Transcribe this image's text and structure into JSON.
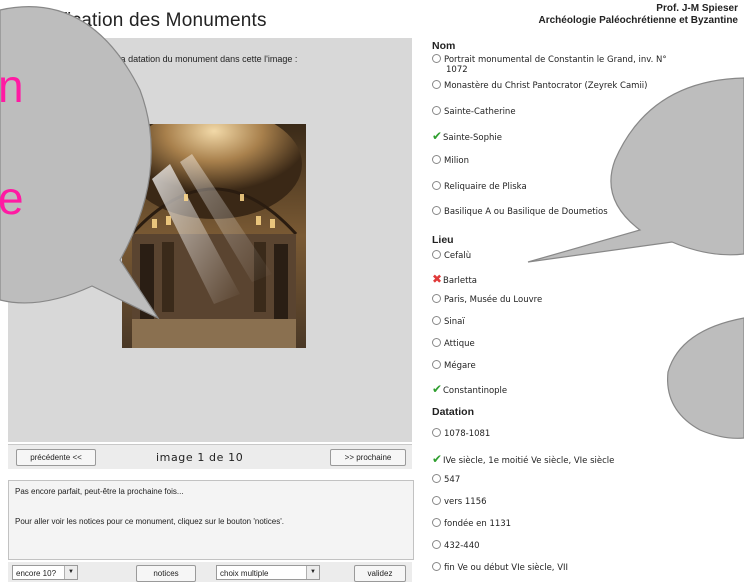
{
  "title": "Identification des Monuments",
  "author": {
    "name": "Prof. J-M Spieser",
    "course": "Archéologie Paléochrétienne et Byzantine"
  },
  "left": {
    "instruction": "Identifiez le nom, le lieu et la datation du monument dans cette l'image :",
    "nav": {
      "prev_label": "précédente <<",
      "next_label": ">> prochaine",
      "counter": "image 1 de 10"
    },
    "feedback": {
      "line1": "Pas encore parfait, peut-être la prochaine fois...",
      "line2": "Pour aller voir les notices pour ce monument, cliquez sur le bouton 'notices'."
    },
    "bottom": {
      "attempts_value": "encore 10?",
      "notices_label": "notices",
      "mode_value": "choix multiple",
      "validate_label": "validez"
    }
  },
  "sections": {
    "nom": {
      "header": "Nom",
      "options": [
        {
          "label": "Portrait monumental de Constantin le Grand, inv. N°",
          "label2": "1072",
          "state": "radio"
        },
        {
          "label": "Monastère du Christ Pantocrator (Zeyrek Camii)",
          "state": "radio"
        },
        {
          "label": "Sainte-Catherine",
          "state": "radio"
        },
        {
          "label": "Sainte-Sophie",
          "state": "correct"
        },
        {
          "label": "Milion",
          "state": "radio"
        },
        {
          "label": "Reliquaire de Pliska",
          "state": "radio"
        },
        {
          "label": "Basilique A ou Basilique de Doumetios",
          "state": "radio"
        }
      ]
    },
    "lieu": {
      "header": "Lieu",
      "options": [
        {
          "label": "Cefalù",
          "state": "radio"
        },
        {
          "label": "Barletta",
          "state": "wrong"
        },
        {
          "label": "Paris, Musée du Louvre",
          "state": "radio"
        },
        {
          "label": "Sinaï",
          "state": "radio"
        },
        {
          "label": "Attique",
          "state": "radio"
        },
        {
          "label": "Mégare",
          "state": "radio"
        },
        {
          "label": "Constantinople",
          "state": "correct"
        }
      ]
    },
    "datation": {
      "header": "Datation",
      "options": [
        {
          "label": "1078-1081",
          "state": "radio"
        },
        {
          "label": "IVe siècle, 1e moitié Ve siècle, VIe siècle",
          "state": "correct"
        },
        {
          "label": "547",
          "state": "radio"
        },
        {
          "label": "vers 1156",
          "state": "radio"
        },
        {
          "label": "fondée en 1131",
          "state": "radio"
        },
        {
          "label": "432-440",
          "state": "radio"
        },
        {
          "label": "fin Ve ou début VIe siècle, VII",
          "state": "radio"
        }
      ]
    }
  },
  "colors": {
    "correct": "#2e9e2e",
    "wrong": "#e03a3a",
    "panel": "#d8d8d8",
    "callout_fill": "#bdbdbd",
    "callout_text": "#ff1aa3"
  },
  "callout_text": {
    "left_glyph_top": "n",
    "left_glyph_bottom": "e"
  }
}
